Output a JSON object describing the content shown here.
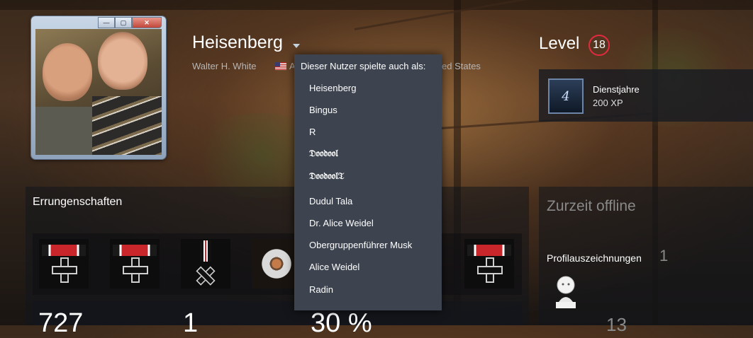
{
  "profile": {
    "name": "Heisenberg",
    "real_name": "Walter H. White",
    "location_visible_start": "A",
    "location_visible_end": "ed States"
  },
  "window_controls": {
    "minimize": "—",
    "maximize": "▢",
    "close": "✕"
  },
  "level": {
    "label": "Level",
    "value": "18"
  },
  "service_badge": {
    "icon_text": "4",
    "title": "Dienstjahre",
    "xp": "200 XP"
  },
  "achievements": {
    "title": "Errungenschaften",
    "stats": [
      "727",
      "1",
      "30 %"
    ]
  },
  "status": {
    "text": "Zurzeit offline",
    "awards_label": "Profilauszeichnungen",
    "awards_count": "1",
    "below_count": "13"
  },
  "aliases_dropdown": {
    "header": "Dieser Nutzer spielte auch als:",
    "items": [
      "Heisenberg",
      "Bingus",
      "R",
      "𝔇𝔬𝔬𝔡𝔬𝔬𝔩",
      "𝔇𝔬𝔬𝔡𝔬𝔬𝔩𝔗",
      "Dudul Tala",
      "Dr. Alice Weidel",
      "Obergruppenführer Musk",
      "Alice Weidel",
      "Radin"
    ]
  },
  "colors": {
    "level_ring": "#e22a3f",
    "dropdown_bg": "#3d4450",
    "muted_text": "#898989"
  }
}
